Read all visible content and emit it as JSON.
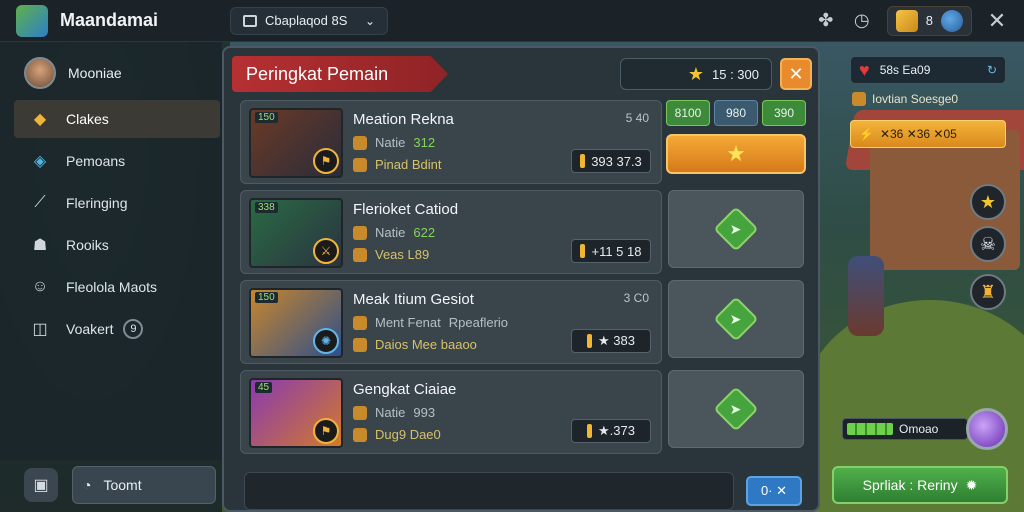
{
  "app": {
    "title": "Maandamai",
    "tab_label": "Cbaplaqod 8S"
  },
  "topbar": {
    "coins_value": "8",
    "close_icon": "✕"
  },
  "profile": {
    "name": "Mooniae"
  },
  "sidebar": {
    "items": [
      {
        "label": "Clakes",
        "icon": "diamond-icon",
        "active": true
      },
      {
        "label": "Pemoans",
        "icon": "shield-icon",
        "active": false
      },
      {
        "label": "Fleringing",
        "icon": "sword-icon",
        "active": false
      },
      {
        "label": "Rooiks",
        "icon": "helmet-icon",
        "active": false
      },
      {
        "label": "Fleololа Maots",
        "icon": "user-icon",
        "active": false
      },
      {
        "label": "Voakert",
        "icon": "bag-icon",
        "active": false,
        "badge": "9"
      }
    ],
    "bottom_button": "Toomt"
  },
  "panel": {
    "title": "Peringkat Pemain",
    "score": "15 : 300",
    "rows": [
      {
        "name": "Meation Rekna",
        "rank": "5 40",
        "line1_label": "Natie",
        "line1_value": "312",
        "line2": "Pinad Bdint",
        "points": "393 37.3",
        "tag": "150"
      },
      {
        "name": "Flerioket Catiod",
        "rank": "",
        "line1_label": "Natie",
        "line1_value": "622",
        "line2": "Veas L89",
        "points": "+11 5 18",
        "tag": "338"
      },
      {
        "name": "Meak Itium Gesiot",
        "rank": "3 C0",
        "line1_label": "Ment Fenat",
        "line1_value": "Rpeaflerio",
        "line2": "Daios Mee baaoo",
        "points": "★ 383",
        "tag": "150"
      },
      {
        "name": "Gengkat Ciaiae",
        "rank": "",
        "line1_label": "Natie",
        "line1_value": "993",
        "line2": "Dug9 Dae0",
        "points": "★.373",
        "tag": "45"
      }
    ],
    "right_tabs": [
      "8100",
      "980",
      "390"
    ],
    "send_label": "0· ✕"
  },
  "hud": {
    "lives": "58s Ea09",
    "quest": "Iovtian Soesge0",
    "bonus": "✕36 ✕36 ✕05",
    "hp": "Omoao",
    "action_button": "Sprliak : Reriny"
  }
}
